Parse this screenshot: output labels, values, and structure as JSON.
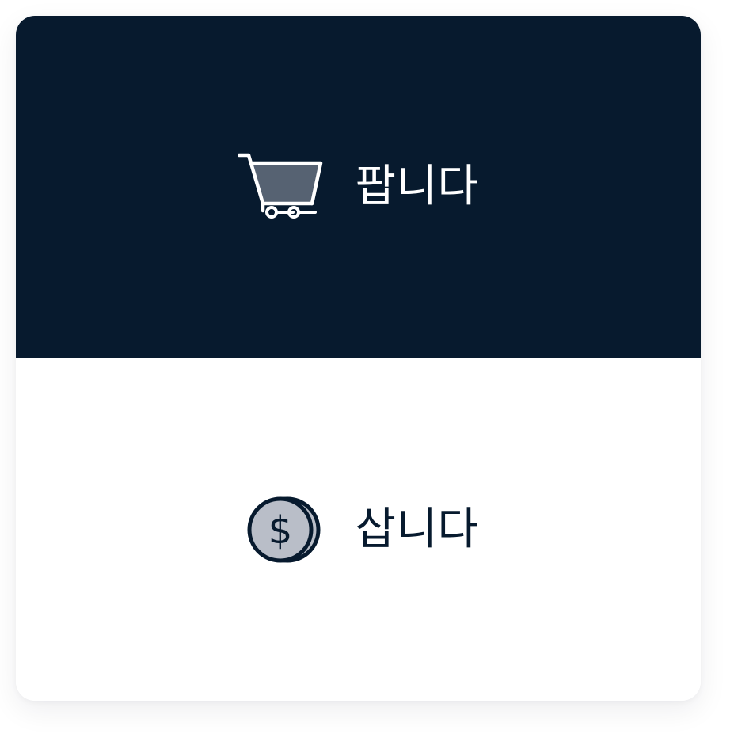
{
  "colors": {
    "navy": "#071a2e",
    "white": "#ffffff",
    "slate_fill": "#566272",
    "coin_fill": "#b9bec8",
    "card_background": "#ffffff"
  },
  "options": [
    {
      "key": "sell",
      "label": "팝니다",
      "icon": "shopping-cart-icon",
      "selected": true
    },
    {
      "key": "buy",
      "label": "삽니다",
      "icon": "coins-dollar-icon",
      "selected": false
    }
  ]
}
